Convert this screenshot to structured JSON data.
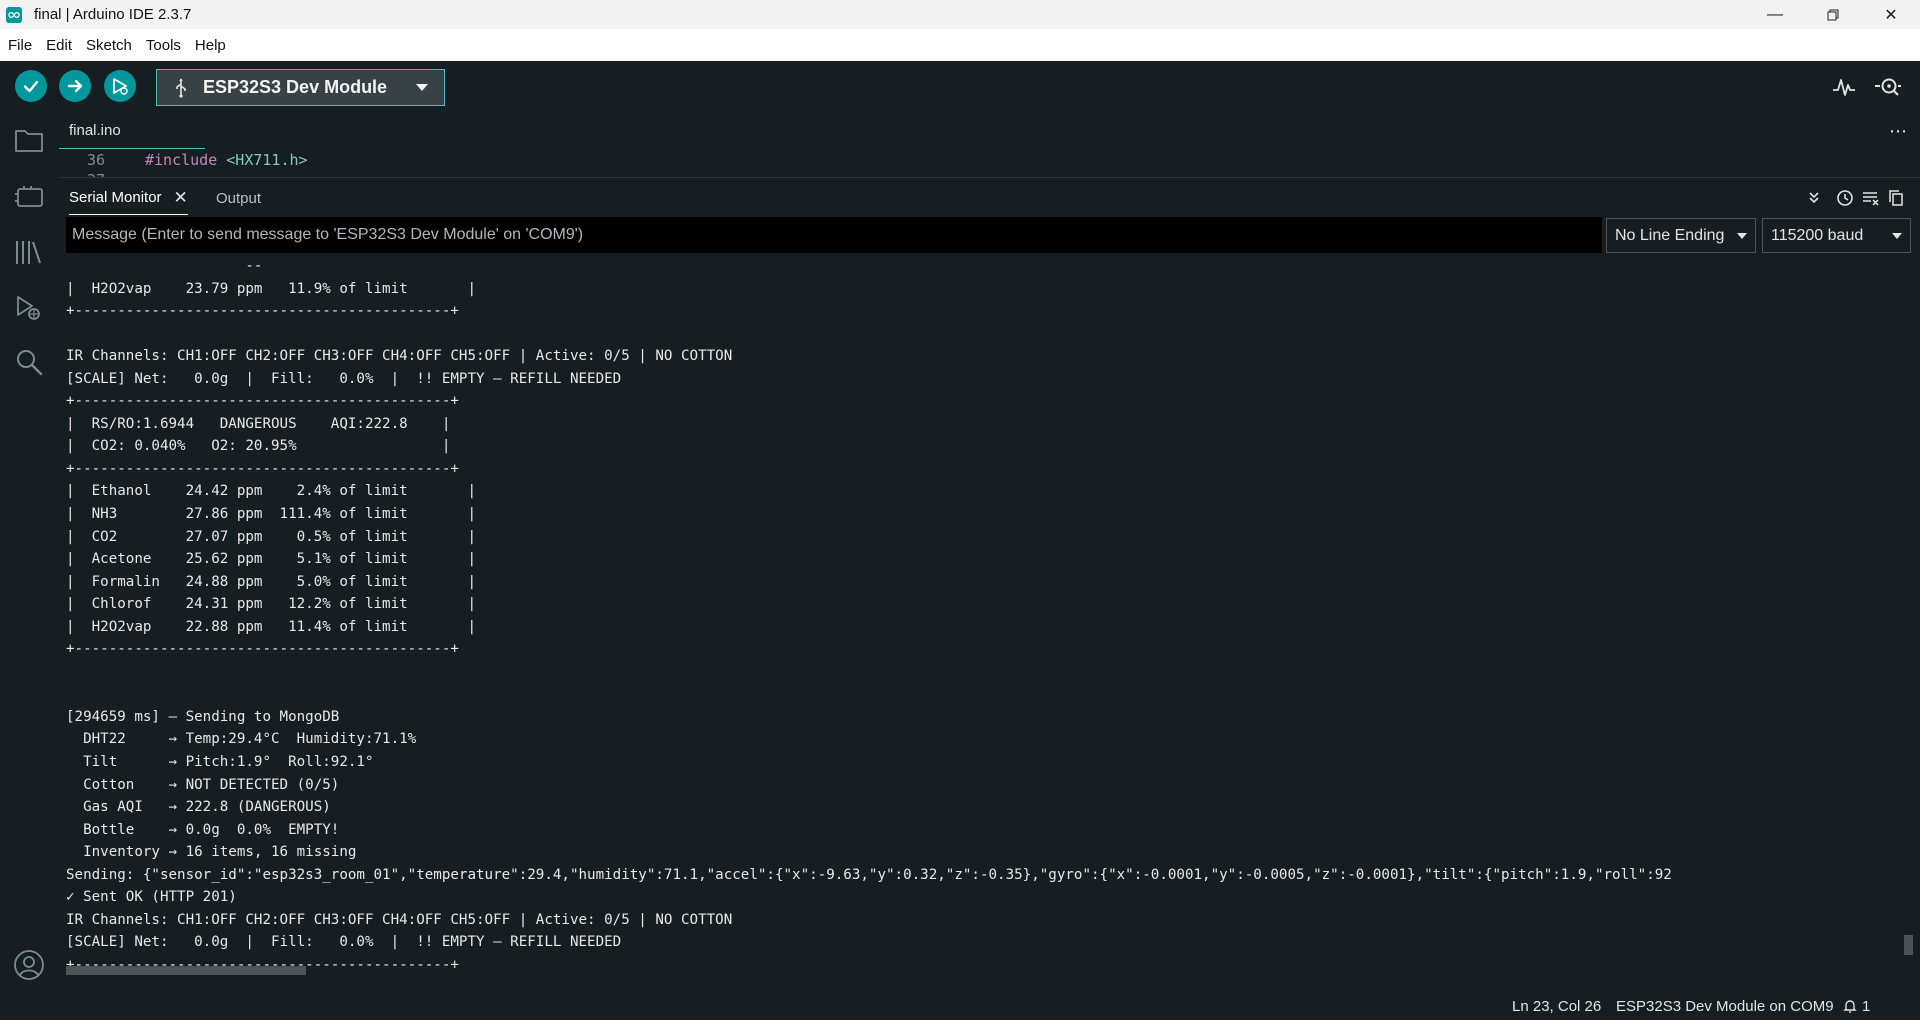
{
  "window": {
    "title": "final | Arduino IDE 2.3.7"
  },
  "menu": [
    "File",
    "Edit",
    "Sketch",
    "Tools",
    "Help"
  ],
  "toolbar": {
    "board": "ESP32S3 Dev Module"
  },
  "editor": {
    "tab": "final.ino",
    "line_number": "36",
    "line_number_next": "37",
    "code_directive": "#include",
    "code_header": "<HX711.h>"
  },
  "panel": {
    "serial_tab": "Serial Monitor",
    "output_tab": "Output",
    "close_glyph": "✕"
  },
  "serial": {
    "placeholder": "Message (Enter to send message to 'ESP32S3 Dev Module' on 'COM9')",
    "line_ending": "No Line Ending",
    "baud": "115200 baud",
    "lines": [
      "                     --",
      "|  H2O2vap    23.79 ppm   11.9% of limit       |",
      "+--------------------------------------------+",
      "",
      "IR Channels: CH1:OFF CH2:OFF CH3:OFF CH4:OFF CH5:OFF | Active: 0/5 | NO COTTON",
      "[SCALE] Net:   0.0g  |  Fill:   0.0%  |  !! EMPTY — REFILL NEEDED",
      "+--------------------------------------------+",
      "|  RS/RO:1.6944   DANGEROUS    AQI:222.8    |",
      "|  CO2: 0.040%   O2: 20.95%                 |",
      "+--------------------------------------------+",
      "|  Ethanol    24.42 ppm    2.4% of limit       |",
      "|  NH3        27.86 ppm  111.4% of limit       |",
      "|  CO2        27.07 ppm    0.5% of limit       |",
      "|  Acetone    25.62 ppm    5.1% of limit       |",
      "|  Formalin   24.88 ppm    5.0% of limit       |",
      "|  Chlorof    24.31 ppm   12.2% of limit       |",
      "|  H2O2vap    22.88 ppm   11.4% of limit       |",
      "+--------------------------------------------+",
      "",
      "",
      "[294659 ms] — Sending to MongoDB",
      "  DHT22     → Temp:29.4°C  Humidity:71.1%",
      "  Tilt      → Pitch:1.9°  Roll:92.1°",
      "  Cotton    → NOT DETECTED (0/5)",
      "  Gas AQI   → 222.8 (DANGEROUS)",
      "  Bottle    → 0.0g  0.0%  EMPTY!",
      "  Inventory → 16 items, 16 missing",
      "Sending: {\"sensor_id\":\"esp32s3_room_01\",\"temperature\":29.4,\"humidity\":71.1,\"accel\":{\"x\":-9.63,\"y\":0.32,\"z\":-0.35},\"gyro\":{\"x\":-0.0001,\"y\":-0.0005,\"z\":-0.0001},\"tilt\":{\"pitch\":1.9,\"roll\":92",
      "✓ Sent OK (HTTP 201)",
      "IR Channels: CH1:OFF CH2:OFF CH3:OFF CH4:OFF CH5:OFF | Active: 0/5 | NO COTTON",
      "[SCALE] Net:   0.0g  |  Fill:   0.0%  |  !! EMPTY — REFILL NEEDED",
      "+--------------------------------------------+"
    ]
  },
  "status": {
    "cursor": "Ln 23, Col 26",
    "port": "ESP32S3 Dev Module on COM9",
    "notifications": "1"
  },
  "colors": {
    "accent": "#00979d",
    "background": "#171e21",
    "input_bg": "#000000"
  }
}
